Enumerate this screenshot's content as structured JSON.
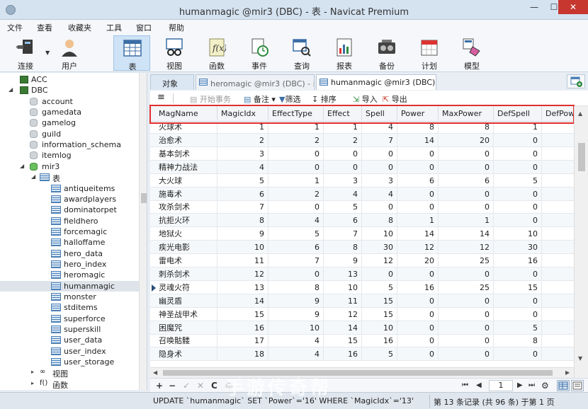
{
  "window": {
    "title": "humanmagic @mir3 (DBC) - 表 - Navicat Premium",
    "minimize": "—",
    "maximize": "☐",
    "close": "✕"
  },
  "menu": [
    "文件",
    "查看",
    "收藏夹",
    "工具",
    "窗口",
    "帮助"
  ],
  "toolbar": [
    {
      "label": "连接",
      "icon": "connection-plug-icon"
    },
    {
      "label": "用户",
      "icon": "user-icon"
    },
    {
      "label": "表",
      "icon": "table-icon",
      "active": true
    },
    {
      "label": "视图",
      "icon": "view-glasses-icon"
    },
    {
      "label": "函数",
      "icon": "function-icon"
    },
    {
      "label": "事件",
      "icon": "event-clock-icon"
    },
    {
      "label": "查询",
      "icon": "query-icon"
    },
    {
      "label": "报表",
      "icon": "report-icon"
    },
    {
      "label": "备份",
      "icon": "backup-icon"
    },
    {
      "label": "计划",
      "icon": "schedule-calendar-icon"
    },
    {
      "label": "模型",
      "icon": "model-icon"
    }
  ],
  "sidebar": {
    "connections": [
      {
        "name": "ACC",
        "expanded": false
      },
      {
        "name": "DBC",
        "expanded": true
      }
    ],
    "databases": [
      "account",
      "gamedata",
      "gamelog",
      "guild",
      "information_schema",
      "itemlog"
    ],
    "active_db": "mir3",
    "tables_group": "表",
    "tables": [
      "antiqueitems",
      "awardplayers",
      "dominatorpet",
      "fieldhero",
      "forcemagic",
      "halloffame",
      "hero_data",
      "hero_index",
      "heromagic",
      "humanmagic",
      "monster",
      "stditems",
      "superforce",
      "superskill",
      "user_data",
      "user_index",
      "user_storage"
    ],
    "selected_table": "humanmagic",
    "views_group": "视图",
    "functions_group": "函数",
    "functions_prefix": "f()",
    "cut_group": "表"
  },
  "tabs": {
    "objects": "对象",
    "hero_tab": "heromagic @mir3 (DBC) - 表",
    "human_tab": "humanmagic @mir3 (DBC) -..."
  },
  "data_toolbar": {
    "menu_icon": "≡",
    "begin_txn": "开始事务",
    "memo": "备注",
    "filter": "筛选",
    "sort": "排序",
    "import": "导入",
    "export": "导出"
  },
  "grid": {
    "columns": [
      "MagName",
      "MagicIdx",
      "EffectType",
      "Effect",
      "Spell",
      "Power",
      "MaxPower",
      "DefSpell",
      "DefPower"
    ],
    "rows": [
      [
        "火球术",
        "1",
        "1",
        "1",
        "4",
        "8",
        "8",
        "1"
      ],
      [
        "治愈术",
        "2",
        "2",
        "2",
        "7",
        "14",
        "20",
        "0"
      ],
      [
        "基本剑术",
        "3",
        "0",
        "0",
        "0",
        "0",
        "0",
        "0"
      ],
      [
        "精神力战法",
        "4",
        "0",
        "0",
        "0",
        "0",
        "0",
        "0"
      ],
      [
        "大火球",
        "5",
        "1",
        "3",
        "3",
        "6",
        "6",
        "5"
      ],
      [
        "施毒术",
        "6",
        "2",
        "4",
        "4",
        "0",
        "0",
        "0"
      ],
      [
        "攻杀剑术",
        "7",
        "0",
        "5",
        "0",
        "0",
        "0",
        "0"
      ],
      [
        "抗拒火环",
        "8",
        "4",
        "6",
        "8",
        "1",
        "1",
        "0"
      ],
      [
        "地狱火",
        "9",
        "5",
        "7",
        "10",
        "14",
        "14",
        "10"
      ],
      [
        "疾光电影",
        "10",
        "6",
        "8",
        "30",
        "12",
        "12",
        "30"
      ],
      [
        "雷电术",
        "11",
        "7",
        "9",
        "12",
        "20",
        "25",
        "16"
      ],
      [
        "刺杀剑术",
        "12",
        "0",
        "13",
        "0",
        "0",
        "0",
        "0"
      ],
      [
        "灵魂火符",
        "13",
        "8",
        "10",
        "5",
        "16",
        "25",
        "15"
      ],
      [
        "幽灵盾",
        "14",
        "9",
        "11",
        "15",
        "0",
        "0",
        "0"
      ],
      [
        "神圣战甲术",
        "15",
        "9",
        "12",
        "15",
        "0",
        "0",
        "0"
      ],
      [
        "困魔咒",
        "16",
        "10",
        "14",
        "10",
        "0",
        "0",
        "5"
      ],
      [
        "召唤骷髅",
        "17",
        "4",
        "15",
        "16",
        "0",
        "0",
        "8"
      ],
      [
        "隐身术",
        "18",
        "4",
        "16",
        "5",
        "0",
        "0",
        "0"
      ]
    ],
    "current_row_index": 12
  },
  "navbar": {
    "add": "+",
    "remove": "−",
    "apply": "✓",
    "discard": "✕",
    "refresh": "C",
    "stop": "◎",
    "first": "⏮",
    "prev": "◀",
    "page": "1",
    "next": "▶",
    "last": "⏭",
    "settings": "⚙"
  },
  "status": {
    "sql": "UPDATE `humanmagic` SET `Power`='16' WHERE `MagicIdx`='13'",
    "record": "第 13 条记录 (共 96 条) 于第 1 页"
  },
  "watermark": "手游传奇帮",
  "colors": {
    "highlight_border": "#e03030",
    "selected_toolbar": "#cfe3f6",
    "tree_db_active": "#6cbf5f"
  }
}
